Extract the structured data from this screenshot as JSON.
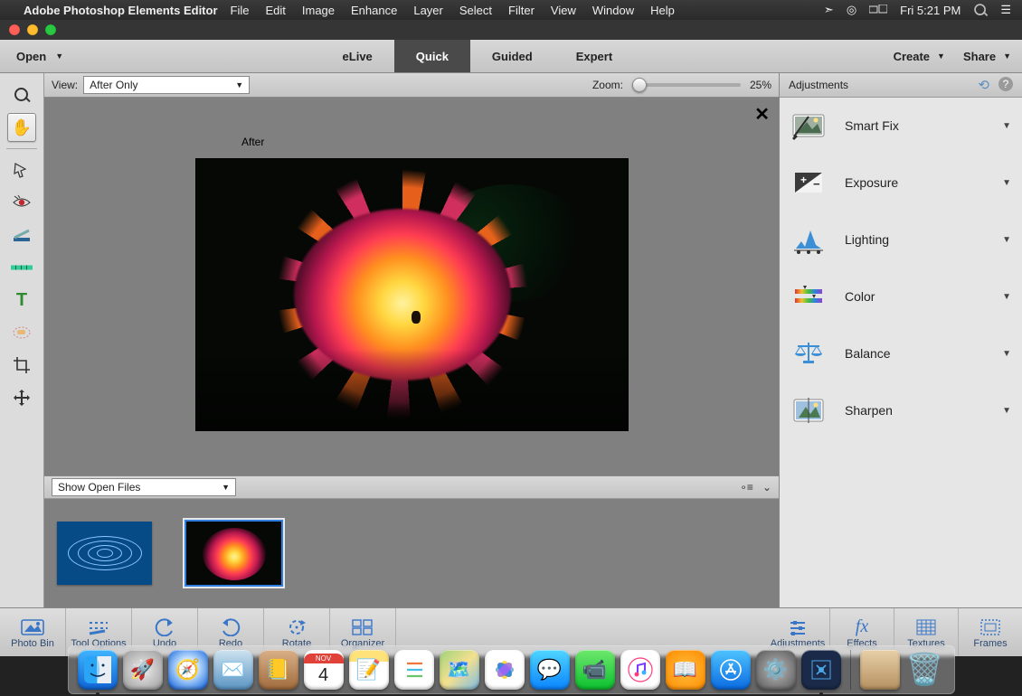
{
  "mac_menubar": {
    "app_name": "Adobe Photoshop Elements Editor",
    "menus": [
      "File",
      "Edit",
      "Image",
      "Enhance",
      "Layer",
      "Select",
      "Filter",
      "View",
      "Window",
      "Help"
    ],
    "clock": "Fri 5:21 PM"
  },
  "appbar": {
    "open_label": "Open",
    "tabs": [
      {
        "label": "eLive",
        "active": false
      },
      {
        "label": "Quick",
        "active": true
      },
      {
        "label": "Guided",
        "active": false
      },
      {
        "label": "Expert",
        "active": false
      }
    ],
    "create_label": "Create",
    "share_label": "Share"
  },
  "viewbar": {
    "view_label": "View:",
    "view_value": "After Only",
    "zoom_label": "Zoom:",
    "zoom_value": "25%"
  },
  "canvas": {
    "after_label": "After"
  },
  "showbar": {
    "select_value": "Show Open Files"
  },
  "rightpanel": {
    "title": "Adjustments",
    "items": [
      {
        "label": "Smart Fix"
      },
      {
        "label": "Exposure"
      },
      {
        "label": "Lighting"
      },
      {
        "label": "Color"
      },
      {
        "label": "Balance"
      },
      {
        "label": "Sharpen"
      }
    ]
  },
  "bottombar": {
    "left": [
      {
        "label": "Photo Bin"
      },
      {
        "label": "Tool Options"
      },
      {
        "label": "Undo"
      },
      {
        "label": "Redo"
      },
      {
        "label": "Rotate"
      },
      {
        "label": "Organizer"
      }
    ],
    "right": [
      {
        "label": "Adjustments"
      },
      {
        "label": "Effects"
      },
      {
        "label": "Textures"
      },
      {
        "label": "Frames"
      }
    ]
  },
  "dock": {
    "date_badge": "4",
    "date_month": "NOV"
  }
}
